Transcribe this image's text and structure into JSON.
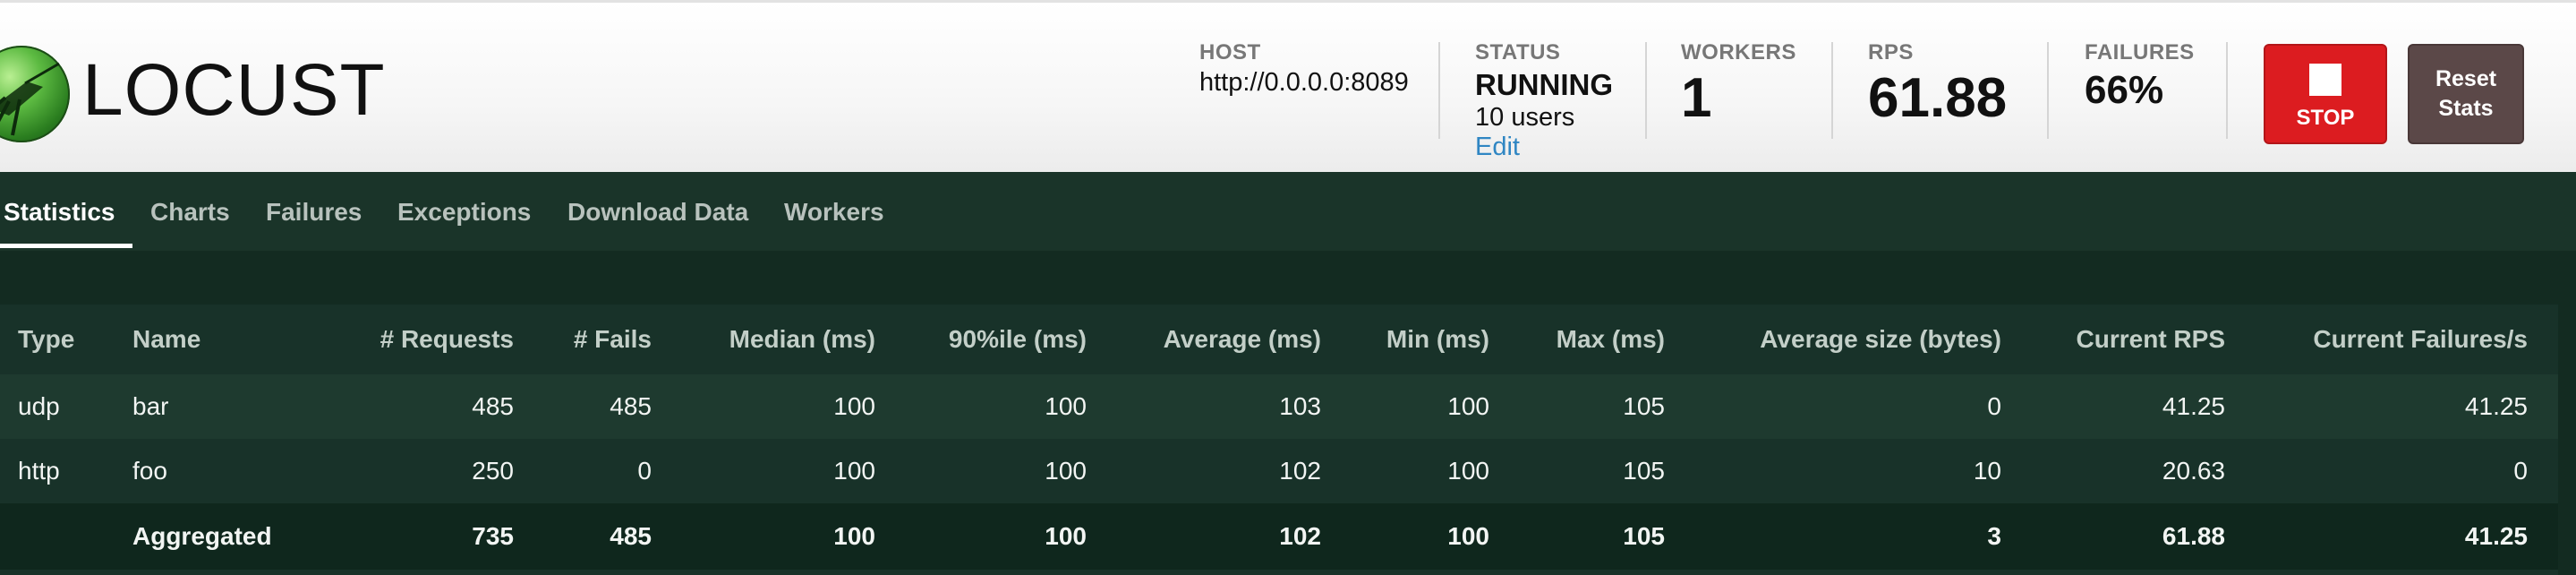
{
  "app": {
    "logo_text": "LOCUST"
  },
  "header": {
    "host": {
      "label": "HOST",
      "value": "http://0.0.0.0:8089"
    },
    "status": {
      "label": "STATUS",
      "value": "RUNNING",
      "users": "10 users",
      "edit_label": "Edit"
    },
    "workers": {
      "label": "WORKERS",
      "value": "1"
    },
    "rps": {
      "label": "RPS",
      "value": "61.88"
    },
    "failures": {
      "label": "FAILURES",
      "value": "66%"
    },
    "stop_label": "STOP",
    "reset_label_line1": "Reset",
    "reset_label_line2": "Stats",
    "colors": {
      "stop": "#dc1c20",
      "reset": "#5b4848",
      "edit_link": "#2f86c3"
    }
  },
  "tabs": [
    {
      "label": "Statistics",
      "active": true
    },
    {
      "label": "Charts"
    },
    {
      "label": "Failures"
    },
    {
      "label": "Exceptions"
    },
    {
      "label": "Download Data"
    },
    {
      "label": "Workers"
    }
  ],
  "table": {
    "columns": [
      "Type",
      "Name",
      "# Requests",
      "# Fails",
      "Median (ms)",
      "90%ile (ms)",
      "Average (ms)",
      "Min (ms)",
      "Max (ms)",
      "Average size (bytes)",
      "Current RPS",
      "Current Failures/s"
    ],
    "rows": [
      [
        "udp",
        "bar",
        "485",
        "485",
        "100",
        "100",
        "103",
        "100",
        "105",
        "0",
        "41.25",
        "41.25"
      ],
      [
        "http",
        "foo",
        "250",
        "0",
        "100",
        "100",
        "102",
        "100",
        "105",
        "10",
        "20.63",
        "0"
      ]
    ],
    "aggregated": [
      "",
      "Aggregated",
      "735",
      "485",
      "100",
      "100",
      "102",
      "100",
      "105",
      "3",
      "61.88",
      "41.25"
    ]
  }
}
